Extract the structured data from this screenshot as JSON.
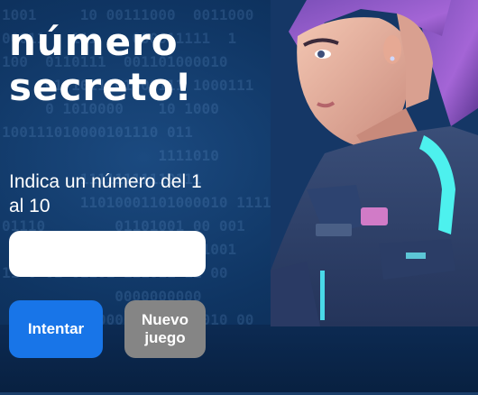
{
  "title": {
    "line1": "número",
    "line2": "secreto!"
  },
  "prompt": "Indica un número del 1 al 10",
  "input": {
    "value": "",
    "placeholder": ""
  },
  "buttons": {
    "try_label": "Intentar",
    "new_game_label": "Nuevo\njuego"
  },
  "background_binary": [
    "1001     10 00111000  0011000",
    "00011   111    000011111  1",
    "100  0110111  001101000010",
    "     01 1011101000111 1000111",
    "     0 1010000    10 1000",
    "100111010000101110 011",
    "                  1111010",
    "         11111111110111",
    "         11010001101000010 1111",
    "01110        01101001 00 001",
    "                   10001001",
    "11 0 01 01101 111011 11 00",
    "             0000000000",
    "        0110000100  000010 00",
    "101 00011000000 1101000101 11011",
    "11 011"
  ],
  "colors": {
    "background": "#0d2a4d",
    "primary_button": "#1875e8",
    "secondary_button": "#858585",
    "text": "#ffffff"
  }
}
